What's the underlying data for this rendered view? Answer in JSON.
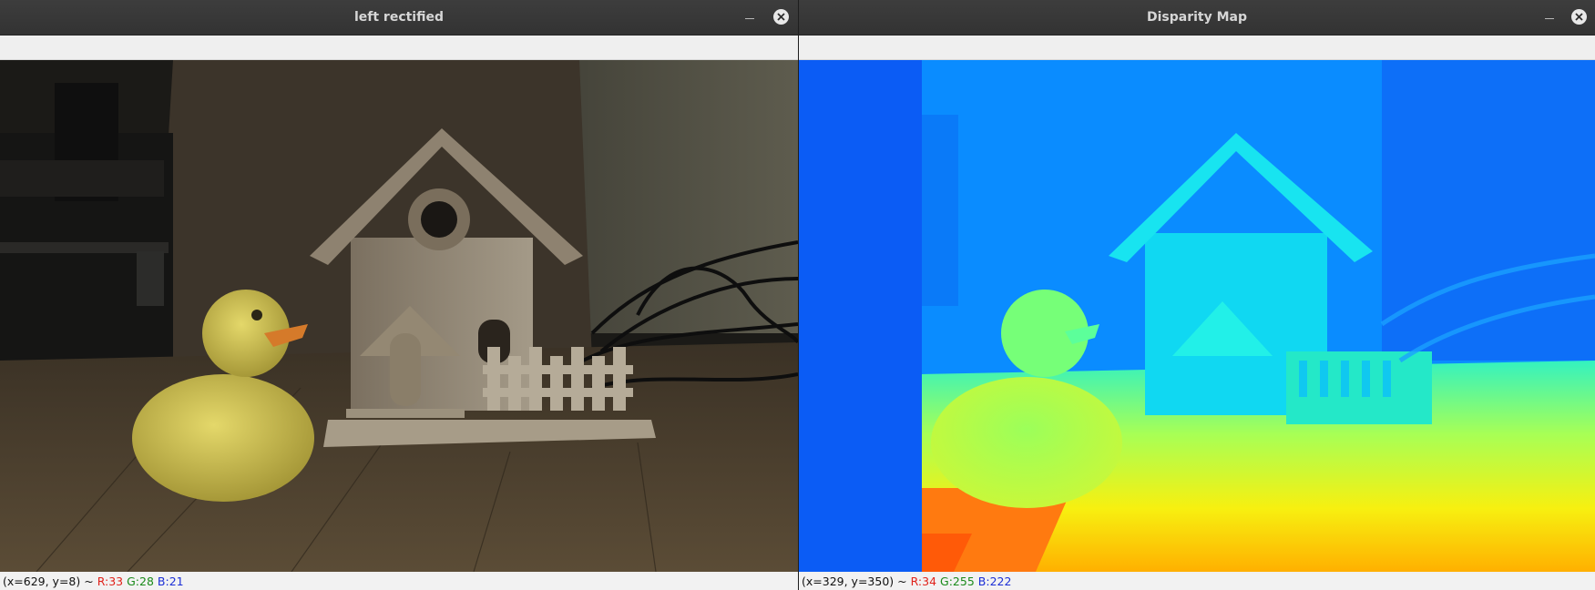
{
  "windows": [
    {
      "title": "left rectified",
      "status": {
        "coords": "(x=629, y=8)",
        "sep": "~",
        "r": "R:33",
        "g": "G:28",
        "b": "B:21"
      },
      "image": "rectified grayscale-tinted stereo frame: rubber duck beside wooden birdhouse with picket fence on a wooden table"
    },
    {
      "title": "Disparity Map",
      "status": {
        "coords": "(x=329, y=350)",
        "sep": "~",
        "r": "R:34",
        "g": "G:255",
        "b": "B:222"
      },
      "image": "jet-colormap disparity map of the same scene"
    }
  ],
  "colors": {
    "titlebar": "#363636",
    "title_text": "#d6d6d6",
    "status_red": "#e0221b",
    "status_green": "#1a8a1a",
    "status_blue": "#1c2fd6"
  },
  "icons": {
    "minimize": "minimize-icon",
    "close": "close-icon"
  }
}
